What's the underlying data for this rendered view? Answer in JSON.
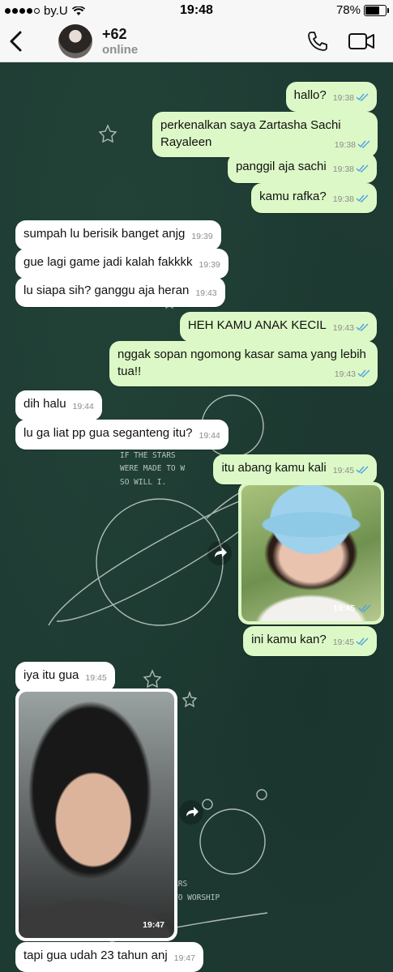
{
  "status_bar": {
    "carrier": "by.U",
    "time": "19:48",
    "battery": "78%",
    "battery_level": 0.78
  },
  "header": {
    "contact_name": "+62",
    "contact_status": "online"
  },
  "messages": [
    {
      "dir": "out",
      "text": "hallo?",
      "time": "19:38"
    },
    {
      "dir": "out",
      "text": "perkenalkan saya Zartasha Sachi Rayaleen",
      "time": "19:38"
    },
    {
      "dir": "out",
      "text": "panggil aja sachi",
      "time": "19:38"
    },
    {
      "dir": "out",
      "text": "kamu rafka?",
      "time": "19:38"
    },
    {
      "dir": "in",
      "text": "sumpah lu berisik banget anjg",
      "time": "19:39"
    },
    {
      "dir": "in",
      "text": "gue lagi game jadi kalah fakkkk",
      "time": "19:39"
    },
    {
      "dir": "in",
      "text": "lu siapa sih? ganggu aja heran",
      "time": "19:43"
    },
    {
      "dir": "out",
      "text": "HEH KAMU ANAK KECIL",
      "time": "19:43"
    },
    {
      "dir": "out",
      "text": "nggak sopan ngomong kasar sama yang lebih tua!!",
      "time": "19:43"
    },
    {
      "dir": "in",
      "text": "dih halu",
      "time": "19:44"
    },
    {
      "dir": "in",
      "text": "lu ga liat pp gua seganteng itu?",
      "time": "19:44"
    },
    {
      "dir": "out",
      "text": "itu abang kamu kali",
      "time": "19:45"
    },
    {
      "dir": "out",
      "photo": "child-in-blue-bucket-hat",
      "time": "19:45"
    },
    {
      "dir": "out",
      "text": "ini kamu kan?",
      "time": "19:45"
    },
    {
      "dir": "in",
      "text": "iya itu gua",
      "time": "19:45"
    },
    {
      "dir": "in",
      "photo": "young-man-selfie",
      "time": "19:47"
    },
    {
      "dir": "in",
      "text": "tapi gua udah 23 tahun anj",
      "time": "19:47"
    }
  ],
  "wallpaper_text": [
    "IF THE STARS",
    "WERE MADE TO W",
    "SO WILL I.",
    "ARS",
    "TO WORSHIP"
  ],
  "colors": {
    "outgoing": "#dcf8c6",
    "incoming": "#ffffff",
    "read_ticks": "#4fa3e0",
    "background": "#1e3b33"
  }
}
